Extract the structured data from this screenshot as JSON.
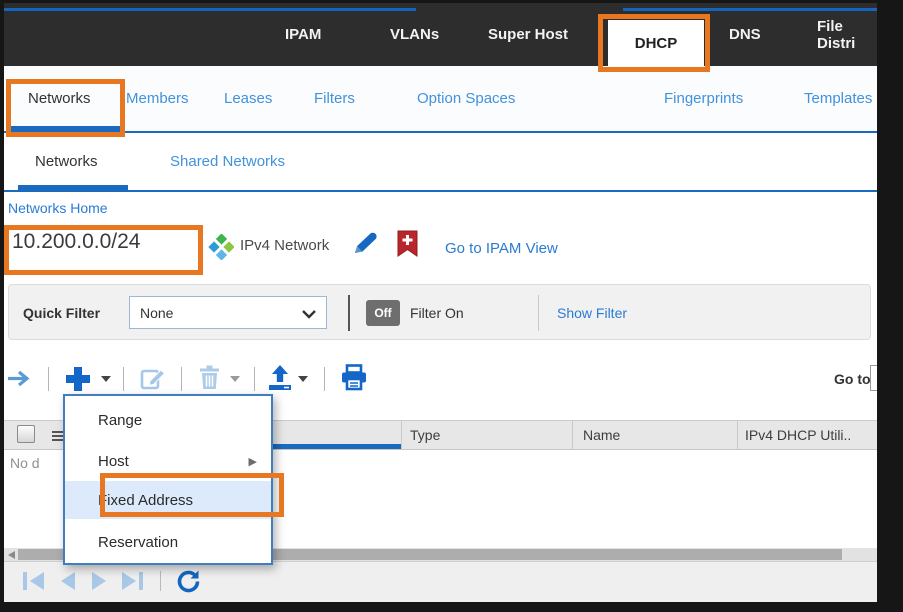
{
  "topbar": {
    "items": [
      {
        "label": "IPAM",
        "active": false
      },
      {
        "label": "VLANs",
        "active": false
      },
      {
        "label": "Super Host",
        "active": false
      },
      {
        "label": "DHCP",
        "active": true
      },
      {
        "label": "DNS",
        "active": false
      },
      {
        "label": "File Distri",
        "active": false
      }
    ]
  },
  "nav2": {
    "items": [
      {
        "label": "Networks",
        "active": true
      },
      {
        "label": "Members",
        "active": false
      },
      {
        "label": "Leases",
        "active": false
      },
      {
        "label": "Filters",
        "active": false
      },
      {
        "label": "Option Spaces",
        "active": false
      },
      {
        "label": "Fingerprints",
        "active": false
      },
      {
        "label": "Templates",
        "active": false
      }
    ]
  },
  "subtabs": {
    "items": [
      {
        "label": "Networks",
        "active": true
      },
      {
        "label": "Shared Networks",
        "active": false
      }
    ]
  },
  "breadcrumb": {
    "label": "Networks Home"
  },
  "network": {
    "cidr": "10.200.0.0/24",
    "type_label": "IPv4 Network",
    "ipam_link": "Go to IPAM View"
  },
  "quick_filter": {
    "label": "Quick Filter",
    "value": "None",
    "toggle": "Off",
    "toggle_label": "Filter On",
    "show_filter": "Show Filter"
  },
  "toolbar": {
    "goto_label": "Go to",
    "goto_value": "",
    "disabled_icons": [
      "edit",
      "delete"
    ],
    "enabled_icons": [
      "forward-arrow",
      "add",
      "import",
      "print"
    ]
  },
  "table": {
    "columns": [
      {
        "label": "Type"
      },
      {
        "label": "Name"
      },
      {
        "label": "IPv4 DHCP Utili.."
      }
    ],
    "empty_text": "No d",
    "sorted_first_column": true
  },
  "menu": {
    "items": [
      {
        "label": "Range",
        "submenu": false,
        "highlighted": false
      },
      {
        "label": "Host",
        "submenu": true,
        "highlighted": false
      },
      {
        "label": "Fixed Address",
        "submenu": false,
        "highlighted": true
      },
      {
        "label": "Reservation",
        "submenu": false,
        "highlighted": false
      }
    ]
  },
  "icons": {
    "network-icon": "four-diamonds green/lime/blue/teal",
    "edit-pencil-icon": "blue pencil",
    "bookmark-add-icon": "red bookmark with white plus",
    "refresh-icon": "blue circular arrows",
    "pager-icons": "first/prev/next/last pale blue"
  },
  "colors": {
    "accent_blue": "#1a6bc0",
    "link_blue": "#2b7bd3",
    "annotation_orange": "#e87722",
    "topbar_bg": "#2d2d2d",
    "menu_highlight_bg": "#dceafb",
    "disabled_icon": "#a6c7e7",
    "enabled_icon": "#1467c8",
    "red_badge": "#b9262b"
  }
}
